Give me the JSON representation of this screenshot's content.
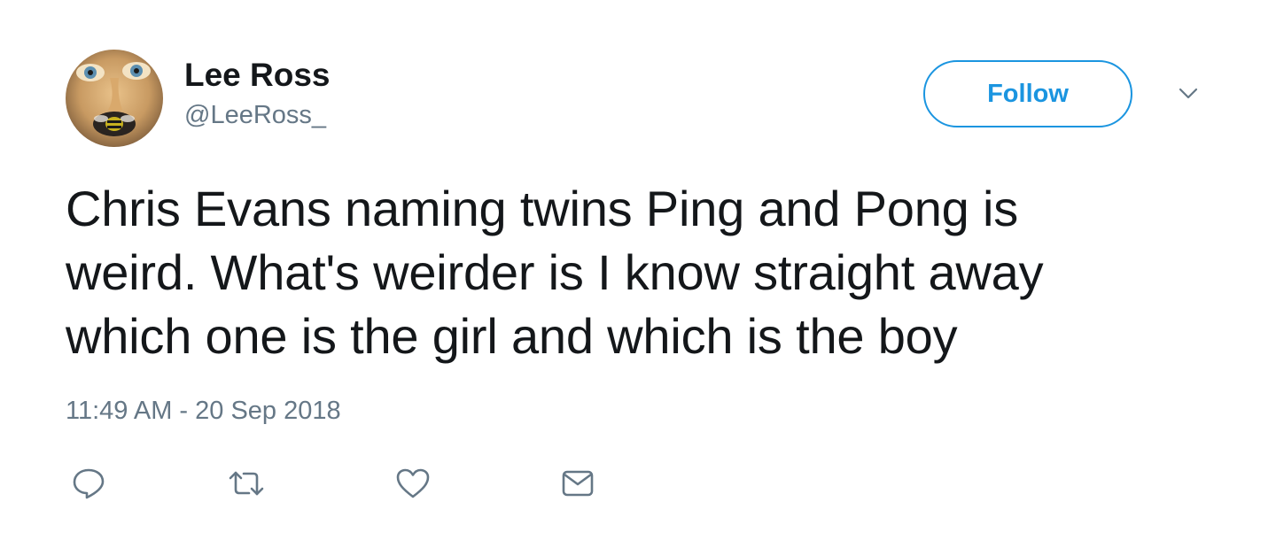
{
  "user": {
    "display_name": "Lee Ross",
    "handle": "@LeeRoss_",
    "avatar_icon": "user-avatar-photo"
  },
  "header": {
    "follow_label": "Follow",
    "menu_icon": "chevron-down-icon"
  },
  "tweet": {
    "lines": [
      "Chris Evans naming twins Ping and Pong is",
      "weird. What's weirder is I know straight away",
      "which one is the girl and which is the boy"
    ],
    "timestamp": "11:49 AM - 20 Sep 2018"
  },
  "actions": {
    "reply_icon": "reply-icon",
    "retweet_icon": "retweet-icon",
    "like_icon": "heart-icon",
    "message_icon": "envelope-icon"
  },
  "colors": {
    "accent": "#1b95e0",
    "secondary_text": "#657786",
    "primary_text": "#14171a"
  }
}
